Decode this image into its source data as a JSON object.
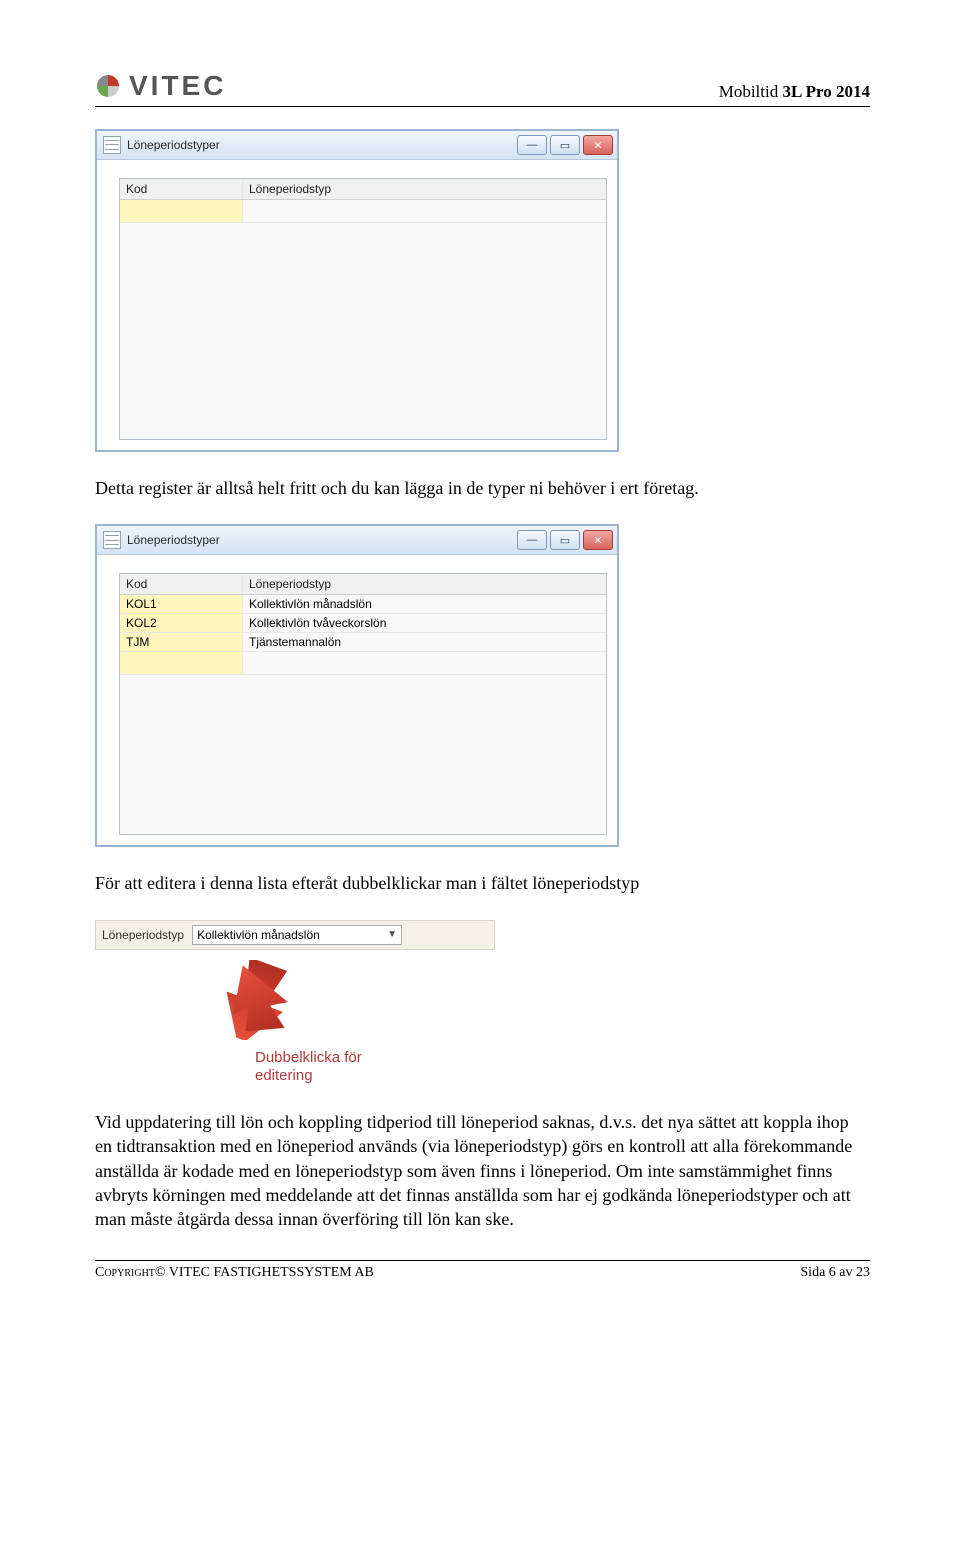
{
  "header": {
    "logo_text": "VITEC",
    "title_light": "Mobiltid ",
    "title_bold": "3L Pro 2014"
  },
  "window1": {
    "title": "Löneperiodstyper",
    "col_kod": "Kod",
    "col_typ": "Löneperiodstyp"
  },
  "paragraph1": "Detta register är alltså helt fritt och du kan lägga in de typer ni behöver i ert företag.",
  "window2": {
    "title": "Löneperiodstyper",
    "col_kod": "Kod",
    "col_typ": "Löneperiodstyp",
    "rows": [
      {
        "kod": "KOL1",
        "typ": "Kollektivlön månadslön"
      },
      {
        "kod": "KOL2",
        "typ": "Kollektivlön tvåveckorslön"
      },
      {
        "kod": "TJM",
        "typ": "Tjänstemannalön"
      }
    ]
  },
  "paragraph2": "För att editera i denna lista efteråt dubbelklickar man i fältet löneperiodstyp",
  "dropdown": {
    "label": "Löneperiodstyp",
    "value": "Kollektivlön månadslön"
  },
  "arrow_caption_line1": "Dubbelklicka för",
  "arrow_caption_line2": "editering",
  "paragraph3": "Vid uppdatering till lön och koppling tidperiod till löneperiod saknas, d.v.s. det nya sättet att koppla ihop en tidtransaktion med en löneperiod används (via löneperiodstyp) görs en kontroll att alla förekommande anställda är kodade med en löneperiodstyp som även finns i löneperiod. Om inte samstämmighet finns avbryts körningen med meddelande att det finnas anställda som har ej godkända löneperiodstyper och att man måste åtgärda dessa innan överföring till lön kan ske.",
  "footer": {
    "left": "Copyright© VITEC FASTIGHETSSYSTEM AB",
    "right": "Sida 6 av 23"
  }
}
